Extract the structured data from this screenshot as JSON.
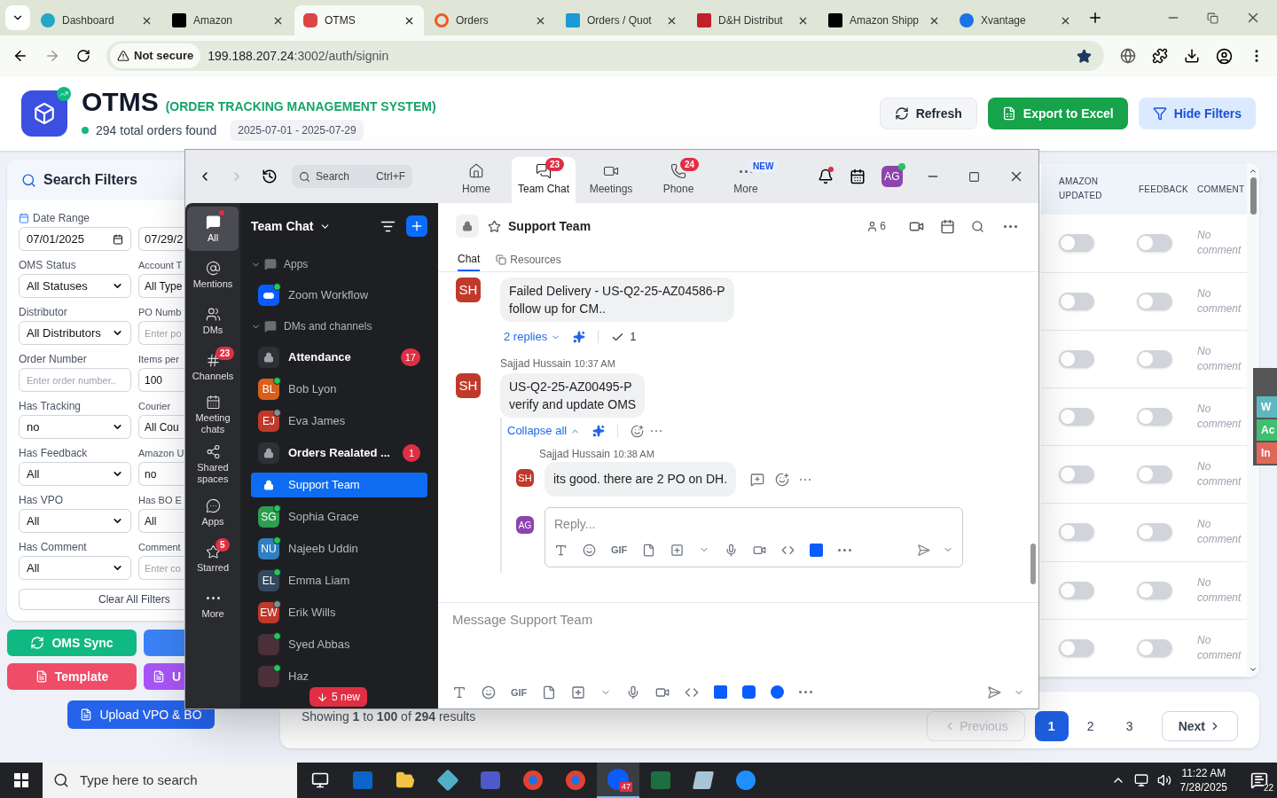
{
  "browser": {
    "tabs": [
      {
        "title": "Dashboard",
        "selected": false
      },
      {
        "title": "Amazon",
        "selected": false
      },
      {
        "title": "OTMS",
        "selected": true
      },
      {
        "title": "Orders",
        "selected": false
      },
      {
        "title": "Orders / Quot",
        "selected": false
      },
      {
        "title": "D&H Distribut",
        "selected": false
      },
      {
        "title": "Amazon Shipp",
        "selected": false
      },
      {
        "title": "Xvantage",
        "selected": false
      }
    ],
    "security": "Not secure",
    "url_host": "199.188.207.24",
    "url_path": ":3002/auth/signin"
  },
  "app": {
    "title": "OTMS",
    "subtitle": "(ORDER TRACKING MANAGEMENT SYSTEM)",
    "orders_found": "294 total orders found",
    "date_range": "2025-07-01 - 2025-07-29",
    "buttons": [
      "Refresh",
      "Export to Excel",
      "Hide Filters"
    ]
  },
  "filters": {
    "title": "Search Filters",
    "date_label": "Date Range",
    "dates": [
      "07/01/2025",
      "07/29/2"
    ],
    "fields": [
      {
        "label": "OMS Status",
        "kind": "select",
        "value": "All Statuses"
      },
      {
        "label": "Account T",
        "kind": "select",
        "value": "All Type"
      },
      {
        "label": "Distributor",
        "kind": "select",
        "value": "All Distributors"
      },
      {
        "label": "PO Numb",
        "kind": "input",
        "placeholder": "Enter po"
      },
      {
        "label": "Order Number",
        "kind": "input",
        "placeholder": "Enter order number.."
      },
      {
        "label": "Items per",
        "kind": "input",
        "value": "100"
      },
      {
        "label": "Has Tracking",
        "kind": "select",
        "value": "no"
      },
      {
        "label": "Courier",
        "kind": "select",
        "value": "All Cou"
      },
      {
        "label": "Has Feedback",
        "kind": "select",
        "value": "All"
      },
      {
        "label": "Amazon U",
        "kind": "select",
        "value": "no"
      },
      {
        "label": "Has VPO",
        "kind": "select",
        "value": "All"
      },
      {
        "label": "Has BO E",
        "kind": "select",
        "value": "All"
      },
      {
        "label": "Has Comment",
        "kind": "select",
        "value": "All"
      },
      {
        "label": "Comment",
        "kind": "input",
        "placeholder": "Enter co"
      }
    ],
    "clear": "Clear All Filters"
  },
  "actions": [
    {
      "label": "OMS Sync",
      "color": "#10b981"
    },
    {
      "color": "#3b82f6"
    },
    {
      "label": "Template",
      "color": "#ef4c68"
    },
    {
      "label": "U",
      "color": "#a855f7"
    }
  ],
  "upload": "Upload VPO & BO",
  "table": {
    "columns": [
      "AMAZON UPDATED",
      "FEEDBACK",
      "COMMENT"
    ],
    "rows": [
      {
        "amazon_updated": false,
        "feedback": false,
        "comment": "No comment"
      },
      {
        "amazon_updated": false,
        "feedback": false,
        "comment": "No comment"
      },
      {
        "amazon_updated": false,
        "feedback": false,
        "comment": "No comment"
      },
      {
        "amazon_updated": false,
        "feedback": false,
        "comment": "No comment"
      },
      {
        "amazon_updated": false,
        "feedback": false,
        "comment": "No comment"
      },
      {
        "amazon_updated": false,
        "feedback": false,
        "comment": "No comment"
      },
      {
        "amazon_updated": false,
        "feedback": false,
        "comment": "No comment"
      },
      {
        "amazon_updated": false,
        "feedback": false,
        "comment": "No comment"
      }
    ]
  },
  "side_tabs": [
    {
      "text": "W",
      "color": "#5fb8c0"
    },
    {
      "text": "Ac",
      "color": "#3fbf6f"
    },
    {
      "text": "In",
      "color": "#e0685a"
    }
  ],
  "pagination": {
    "summary": "Showing **1** to **100** of **294** results",
    "previous": {
      "label": "Previous",
      "disabled": true
    },
    "pages": [
      {
        "label": "1",
        "selected": true
      },
      {
        "label": "2",
        "selected": false
      },
      {
        "label": "3",
        "selected": false
      }
    ],
    "next": "Next"
  },
  "zoom": {
    "search": {
      "placeholder": "Search",
      "shortcut": "Ctrl+F"
    },
    "nav": [
      {
        "label": "Home",
        "selected": false
      },
      {
        "label": "Team Chat",
        "selected": true,
        "badge": "23"
      },
      {
        "label": "Meetings",
        "selected": false
      },
      {
        "label": "Phone",
        "selected": false,
        "badge": "24"
      },
      {
        "label": "More",
        "selected": false,
        "tag": "NEW"
      }
    ],
    "avatar": "AG",
    "notification_dot": true,
    "rail": [
      {
        "label": "All",
        "selected": true,
        "dot": true
      },
      {
        "label": "Mentions",
        "selected": false
      },
      {
        "label": "DMs",
        "selected": false
      },
      {
        "label": "Channels",
        "selected": false,
        "badge": "23"
      },
      {
        "label": "Meeting chats",
        "selected": false
      },
      {
        "label": "Shared spaces",
        "selected": false
      },
      {
        "label": "Apps",
        "selected": false
      },
      {
        "label": "Starred",
        "selected": false,
        "badge": "5"
      },
      {
        "label": "More",
        "selected": false
      }
    ],
    "list_title": "Team Chat",
    "sections": [
      {
        "title": "Apps",
        "expanded": true,
        "items": [
          {
            "name": "Zoom Workflow",
            "kind": "app",
            "online": true,
            "selected": false
          }
        ]
      },
      {
        "title": "DMs and channels",
        "expanded": true,
        "items": [
          {
            "name": "Attendance",
            "kind": "channel",
            "bold": true,
            "badge": "17",
            "selected": false
          },
          {
            "name": "Bob Lyon",
            "kind": "person",
            "initials": "BL",
            "color": "#d9601a",
            "online": true,
            "selected": false
          },
          {
            "name": "Eva James",
            "kind": "person",
            "initials": "EJ",
            "color": "#c0392b",
            "online": false,
            "selected": false
          },
          {
            "name": "Orders Realated ...",
            "kind": "channel",
            "bold": true,
            "badge": "1",
            "selected": false
          },
          {
            "name": "Support Team",
            "kind": "channel",
            "selected": true
          },
          {
            "name": "Sophia Grace",
            "kind": "person",
            "initials": "SG",
            "color": "#2e9e4f",
            "online": true,
            "selected": false
          },
          {
            "name": "Najeeb Uddin",
            "kind": "person",
            "initials": "NU",
            "color": "#2f7fc1",
            "online": true,
            "selected": false
          },
          {
            "name": "Emma Liam",
            "kind": "person",
            "initials": "EL",
            "color": "#34495e",
            "online": true,
            "selected": false
          },
          {
            "name": "Erik Wills",
            "kind": "person",
            "initials": "EW",
            "color": "#c0392b",
            "online": false,
            "selected": false
          },
          {
            "name": "Syed Abbas",
            "kind": "photo",
            "online": true,
            "selected": false
          },
          {
            "name": "Haz",
            "kind": "photo",
            "online": true,
            "selected": false
          }
        ]
      }
    ],
    "new_pill": "5 new",
    "channel": {
      "name": "Support Team",
      "members": "6",
      "tabs": [
        {
          "label": "Chat",
          "selected": true
        },
        {
          "label": "Resources",
          "selected": false
        }
      ]
    },
    "messages": [
      {
        "avatar": "SH",
        "text": "Failed Delivery - US-Q2-25-AZ04586-P\nfollow up for CM..",
        "replies": "2 replies",
        "check_count": "1"
      },
      {
        "author": "Sajjad Hussain",
        "time": "10:37 AM",
        "avatar": "SH",
        "text": "US-Q2-25-AZ00495-P\nverify and update OMS",
        "collapse": "Collapse all",
        "thread": [
          {
            "author": "Sajjad Hussain",
            "time": "10:38 AM",
            "avatar": "SH",
            "text": "its good. there are 2 PO on DH."
          }
        ]
      }
    ],
    "reply": {
      "avatar": "AG",
      "placeholder": "Reply...",
      "gif": "GIF"
    },
    "composer": {
      "placeholder": "Message Support Team",
      "gif": "GIF"
    }
  },
  "taskbar": {
    "search_placeholder": "Type here to search",
    "apps": [
      {
        "kind": "taskview",
        "selected": false
      },
      {
        "kind": "outlook",
        "selected": false
      },
      {
        "kind": "folder",
        "selected": false
      },
      {
        "kind": "gem",
        "selected": false
      },
      {
        "kind": "teams",
        "selected": false
      },
      {
        "kind": "chrome",
        "selected": false
      },
      {
        "kind": "chrome",
        "selected": false
      },
      {
        "kind": "zoom",
        "selected": true,
        "badge": "47"
      },
      {
        "kind": "excel",
        "selected": false
      },
      {
        "kind": "notes",
        "selected": false
      },
      {
        "kind": "bluebird",
        "selected": false
      }
    ],
    "time": "11:22 AM",
    "date": "7/28/2025",
    "notifications": "22"
  }
}
